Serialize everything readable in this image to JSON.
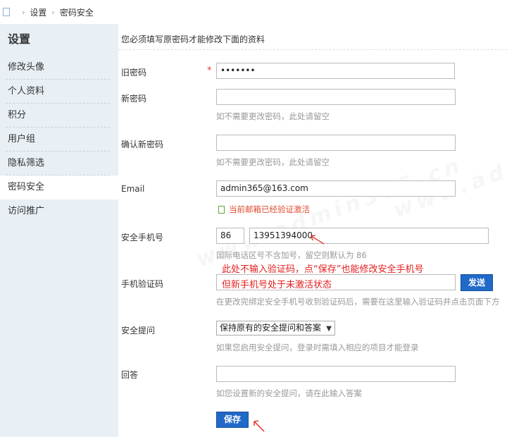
{
  "breadcrumb": {
    "items": [
      "设置",
      "密码安全"
    ]
  },
  "sidebar": {
    "title": "设置",
    "items": [
      {
        "label": "修改头像"
      },
      {
        "label": "个人资料"
      },
      {
        "label": "积分"
      },
      {
        "label": "用户组"
      },
      {
        "label": "隐私筛选"
      },
      {
        "label": "密码安全",
        "active": true
      },
      {
        "label": "访问推广"
      }
    ]
  },
  "form": {
    "notice": "您必须填写原密码才能修改下面的资料",
    "old_password": {
      "label": "旧密码",
      "required_mark": "*",
      "value": "•••••••"
    },
    "new_password": {
      "label": "新密码",
      "value": "",
      "hint": "如不需要更改密码，此处请留空"
    },
    "confirm_password": {
      "label": "确认新密码",
      "value": "",
      "hint": "如不需要更改密码，此处请留空"
    },
    "email": {
      "label": "Email",
      "value": "admin365@163.com",
      "status": "当前邮箱已经验证激活"
    },
    "phone": {
      "label": "安全手机号",
      "country_code": "86",
      "number": "13951394000",
      "hint": "国际电话区号不含加号，留空则默认为 86"
    },
    "verify_code": {
      "label": "手机验证码",
      "value": "",
      "send_label": "发送",
      "hint": "在更改完绑定安全手机号收到验证码后，需要在这里输入验证码并点击页面下方"
    },
    "security_question": {
      "label": "安全提问",
      "selected": "保持原有的安全提问和答案",
      "hint": "如果您启用安全提问，登录时需填入相应的项目才能登录"
    },
    "answer": {
      "label": "回答",
      "value": "",
      "hint": "如您设置新的安全提问，请在此输入答案"
    },
    "save_label": "保存"
  },
  "annotations": {
    "note1": "此处不输入验证码，点“保存”也能修改安全手机号",
    "note2": "但新手机号处于未激活状态"
  },
  "watermark": {
    "text": "www.admin365.cn"
  },
  "colors": {
    "accent": "#2069c8",
    "sidebar_bg": "#e8eff5",
    "annotation": "#e41e1e",
    "verified": "#e04b2f"
  }
}
